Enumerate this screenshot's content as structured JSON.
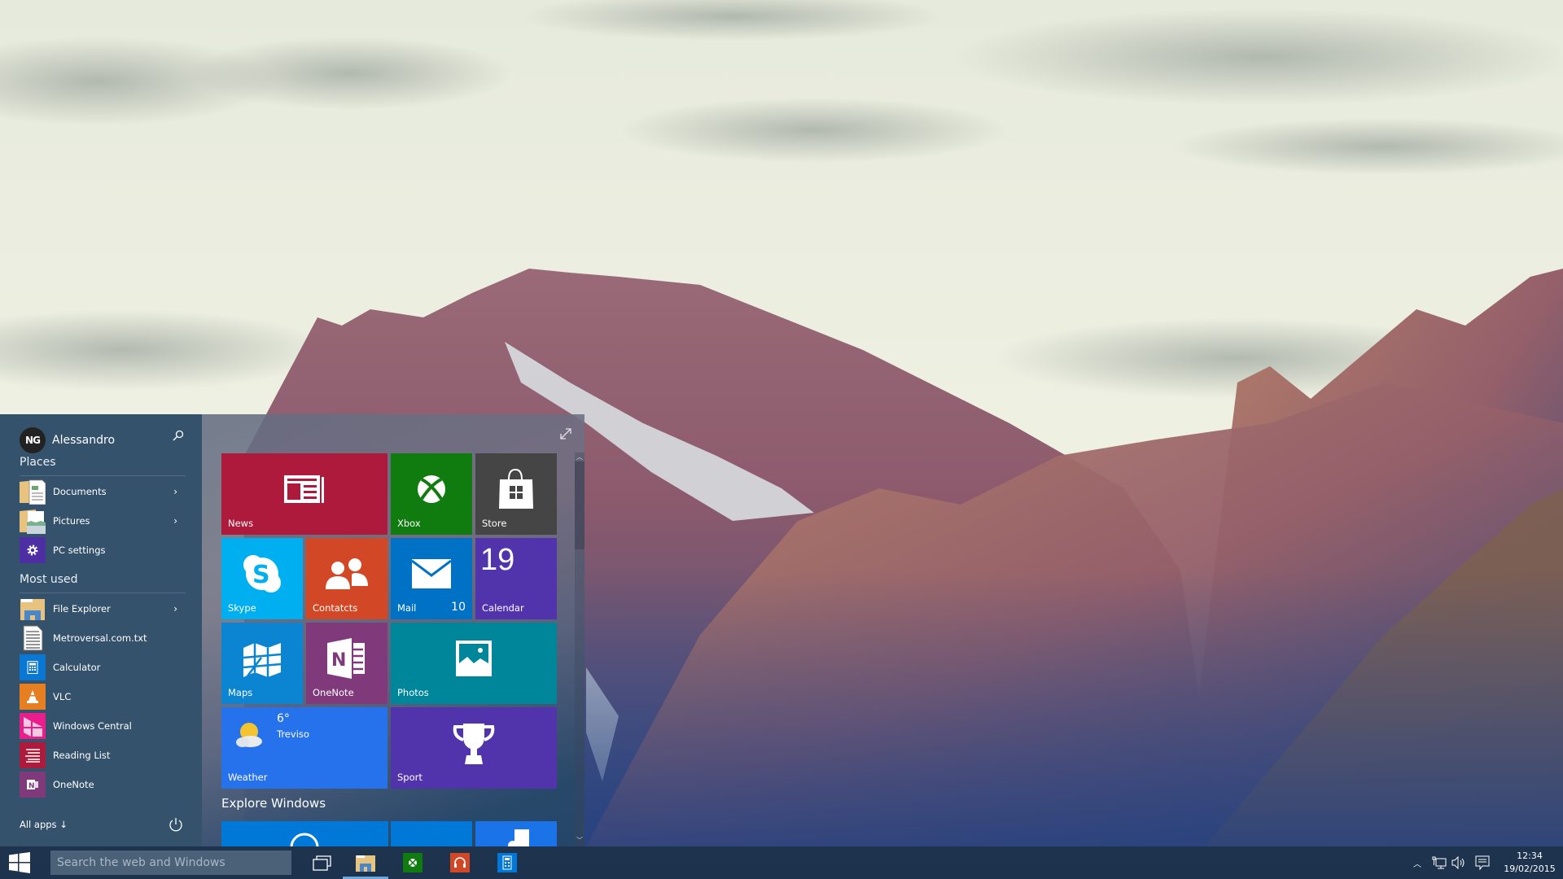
{
  "user": {
    "name": "Alessandro",
    "avatar_initials": "NG"
  },
  "places": {
    "header": "Places",
    "items": [
      {
        "label": "Documents",
        "icon": "documents-folder-icon",
        "has_submenu": true
      },
      {
        "label": "Pictures",
        "icon": "pictures-folder-icon",
        "has_submenu": true
      },
      {
        "label": "PC settings",
        "icon": "gear-icon",
        "has_submenu": false
      }
    ]
  },
  "most_used": {
    "header": "Most used",
    "items": [
      {
        "label": "File Explorer",
        "icon": "file-explorer-icon",
        "has_submenu": true
      },
      {
        "label": "Metroversal.com.txt",
        "icon": "text-document-icon",
        "has_submenu": false
      },
      {
        "label": "Calculator",
        "icon": "calculator-icon",
        "has_submenu": false
      },
      {
        "label": "VLC",
        "icon": "vlc-cone-icon",
        "has_submenu": false
      },
      {
        "label": "Windows Central",
        "icon": "windows-central-icon",
        "has_submenu": false
      },
      {
        "label": "Reading List",
        "icon": "reading-list-icon",
        "has_submenu": false
      },
      {
        "label": "OneNote",
        "icon": "onenote-icon",
        "has_submenu": false
      }
    ]
  },
  "all_apps_label": "All apps ↓",
  "tiles": [
    {
      "id": "news",
      "label": "News",
      "color": "#ae1a3b"
    },
    {
      "id": "xbox",
      "label": "Xbox",
      "color": "#107c10"
    },
    {
      "id": "store",
      "label": "Store",
      "color": "#454545"
    },
    {
      "id": "skype",
      "label": "Skype",
      "color": "#00aff0"
    },
    {
      "id": "contacts",
      "label": "Contatcts",
      "color": "#d24726"
    },
    {
      "id": "mail",
      "label": "Mail",
      "color": "#0072c6",
      "badge": "10"
    },
    {
      "id": "calendar",
      "label": "Calendar",
      "color": "#5133ab",
      "date": "19"
    },
    {
      "id": "maps",
      "label": "Maps",
      "color": "#0b84d1"
    },
    {
      "id": "onenote",
      "label": "OneNote",
      "color": "#80397b"
    },
    {
      "id": "photos",
      "label": "Photos",
      "color": "#00869a"
    },
    {
      "id": "weather",
      "label": "Weather",
      "color": "#2672ec",
      "temperature": "6°",
      "city": "Treviso"
    },
    {
      "id": "sport",
      "label": "Sport",
      "color": "#5133ab"
    }
  ],
  "explore": {
    "header": "Explore Windows",
    "tile_colors": [
      "#0078d7",
      "#0078d7",
      "#1b73e8"
    ]
  },
  "taskbar": {
    "search_placeholder": "Search the web and Windows",
    "pinned": [
      {
        "name": "task-view",
        "active": false
      },
      {
        "name": "file-explorer",
        "active": true
      },
      {
        "name": "xbox",
        "active": false,
        "color": "#107c10"
      },
      {
        "name": "music",
        "active": false,
        "color": "#d24726"
      },
      {
        "name": "calculator",
        "active": false,
        "color": "#0078d7"
      }
    ],
    "clock": {
      "time": "12:34",
      "date": "19/02/2015"
    }
  }
}
